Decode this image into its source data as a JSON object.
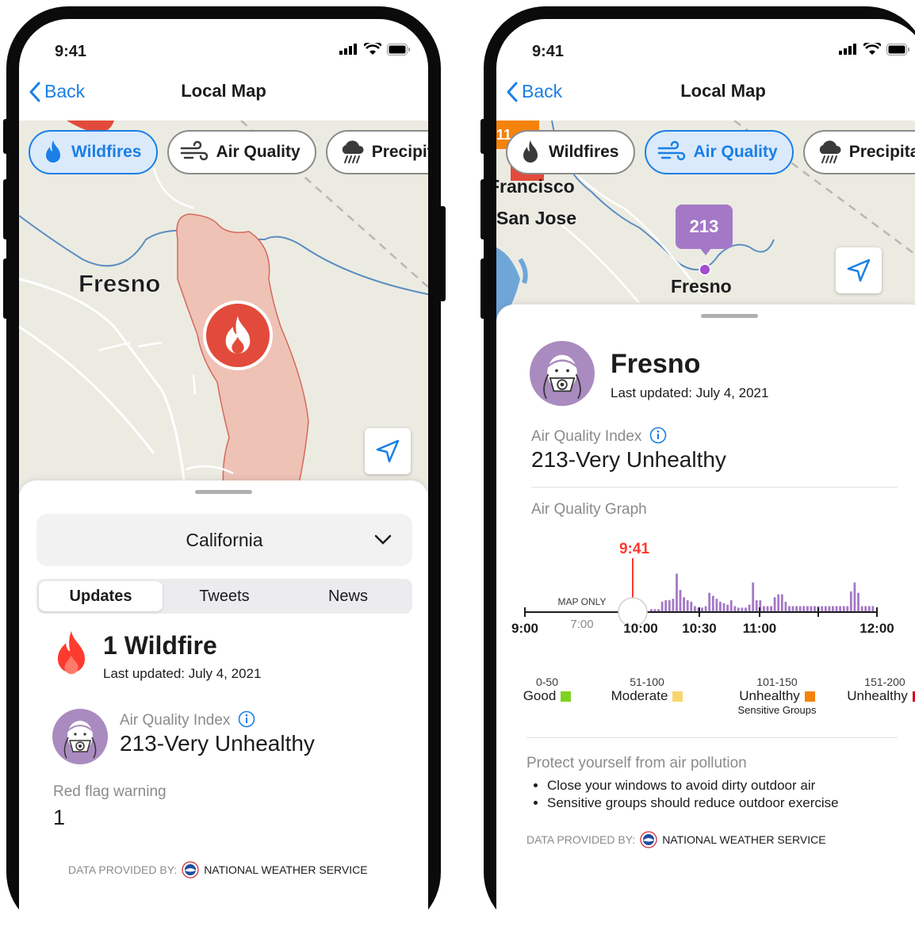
{
  "left": {
    "status": {
      "time": "9:41"
    },
    "nav": {
      "back": "Back",
      "title": "Local Map"
    },
    "chips": [
      {
        "label": "Wildfires",
        "icon": "flame-icon"
      },
      {
        "label": "Air Quality",
        "icon": "wind-icon"
      },
      {
        "label": "Precipitation",
        "icon": "rain-cloud-icon"
      }
    ],
    "map": {
      "city": "Fresno"
    },
    "region": "California",
    "tabs": [
      "Updates",
      "Tweets",
      "News"
    ],
    "fire": {
      "title": "1 Wildfire",
      "updated": "Last updated: July 4, 2021"
    },
    "aqi": {
      "label": "Air Quality Index",
      "value": "213-Very Unhealthy"
    },
    "redflag": {
      "label": "Red flag warning",
      "value": "1"
    },
    "credit": {
      "prefix": "DATA PROVIDED BY:",
      "source": "NATIONAL WEATHER SERVICE"
    }
  },
  "right": {
    "status": {
      "time": "9:41"
    },
    "nav": {
      "back": "Back",
      "title": "Local Map"
    },
    "chips": [
      {
        "label": "Wildfires",
        "icon": "flame-icon"
      },
      {
        "label": "Air Quality",
        "icon": "wind-icon"
      },
      {
        "label": "Precipitation",
        "icon": "rain-cloud-icon"
      }
    ],
    "map": {
      "city": "Fresno",
      "city2": "San Jose",
      "city3": "Francisco",
      "marker": "213",
      "badge": "11"
    },
    "place": {
      "name": "Fresno",
      "updated": "Last updated: July 4, 2021"
    },
    "aqi": {
      "label": "Air Quality Index",
      "value": "213-Very Unhealthy"
    },
    "graph": {
      "title": "Air Quality Graph",
      "now": "9:41",
      "map_only": "MAP ONLY",
      "ticks": [
        "9:00",
        "7:00",
        "10:00",
        "10:30",
        "11:00",
        "12:00"
      ]
    },
    "legend": [
      {
        "range": "0-50",
        "name": "Good",
        "sub": "",
        "color": "#7ed321"
      },
      {
        "range": "51-100",
        "name": "Moderate",
        "sub": "",
        "color": "#f8d66d"
      },
      {
        "range": "101-150",
        "name": "Unhealthy",
        "sub": "Sensitive Groups",
        "color": "#f5820b"
      },
      {
        "range": "151-200",
        "name": "Unhealthy",
        "sub": "",
        "color": "#d0021b"
      }
    ],
    "protect": {
      "title": "Protect yourself from air pollution",
      "tips": [
        "Close your windows to avoid dirty outdoor air",
        "Sensitive groups should reduce outdoor exercise"
      ]
    },
    "credit": {
      "prefix": "DATA PROVIDED BY:",
      "source": "NATIONAL WEATHER SERVICE"
    }
  },
  "chart_data": {
    "type": "bar",
    "title": "Air Quality Graph",
    "xlabel": "",
    "ylabel": "",
    "categories": [
      "9:42",
      "9:44",
      "9:46",
      "9:48",
      "9:50",
      "9:52",
      "9:54",
      "9:56",
      "9:58",
      "10:00",
      "10:02",
      "10:04",
      "10:06",
      "10:08",
      "10:10",
      "10:12",
      "10:14",
      "10:16",
      "10:18",
      "10:20",
      "10:22",
      "10:24",
      "10:26",
      "10:28",
      "10:30",
      "10:32",
      "10:34",
      "10:36",
      "10:38",
      "10:40",
      "10:42",
      "10:44",
      "10:46",
      "10:48",
      "10:50",
      "10:52",
      "10:54",
      "10:56",
      "10:58",
      "11:00",
      "11:02",
      "11:04",
      "11:06",
      "11:08",
      "11:10",
      "11:12",
      "11:14",
      "11:16",
      "11:18",
      "11:20",
      "11:22",
      "11:24",
      "11:26",
      "11:28",
      "11:30",
      "11:32",
      "11:34",
      "11:36",
      "11:38",
      "11:40",
      "11:42",
      "11:44"
    ],
    "values": [
      4,
      4,
      4,
      14,
      16,
      16,
      18,
      52,
      30,
      20,
      16,
      14,
      8,
      6,
      6,
      8,
      26,
      22,
      18,
      14,
      12,
      10,
      16,
      8,
      6,
      6,
      6,
      10,
      40,
      16,
      16,
      8,
      8,
      8,
      20,
      24,
      24,
      14,
      8,
      8,
      8,
      8,
      8,
      8,
      8,
      8,
      8,
      8,
      8,
      8,
      8,
      8,
      8,
      8,
      8,
      28,
      40,
      26,
      8,
      8,
      8,
      8
    ],
    "ylim": [
      0,
      60
    ]
  }
}
